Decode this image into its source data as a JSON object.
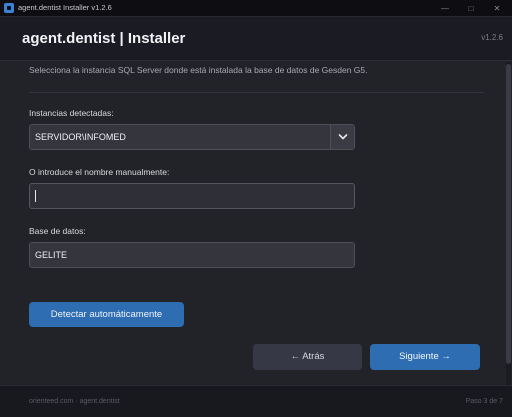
{
  "window": {
    "title": "agent.dentist Installer  v1.2.6",
    "minimize": "—",
    "maximize": "□",
    "close": "✕"
  },
  "header": {
    "title": "agent.dentist  |  Installer",
    "version": "v1.2.6"
  },
  "main": {
    "description": "Selecciona la instancia SQL Server donde está instalada la base de datos de Gesden G5.",
    "instances_label": "Instancias detectadas:",
    "instances_selected": "SERVIDOR\\INFOMED",
    "manual_label": "O introduce el nombre manualmente:",
    "manual_value": "",
    "database_label": "Base de datos:",
    "database_value": "GELITE",
    "detect_button": "Detectar automáticamente"
  },
  "navigation": {
    "back_button": "← Atrás",
    "next_button": "Siguiente →"
  },
  "footer": {
    "left_text": "orienteed.com · agent.dentist",
    "step_text": "Paso 3 de 7"
  },
  "colors": {
    "background": "#222329",
    "header": "#1a1b23",
    "accent": "#2f6db3",
    "field": "#34353d"
  },
  "icons": {
    "app": "app-icon",
    "dropdown": "chevron-down-icon"
  }
}
